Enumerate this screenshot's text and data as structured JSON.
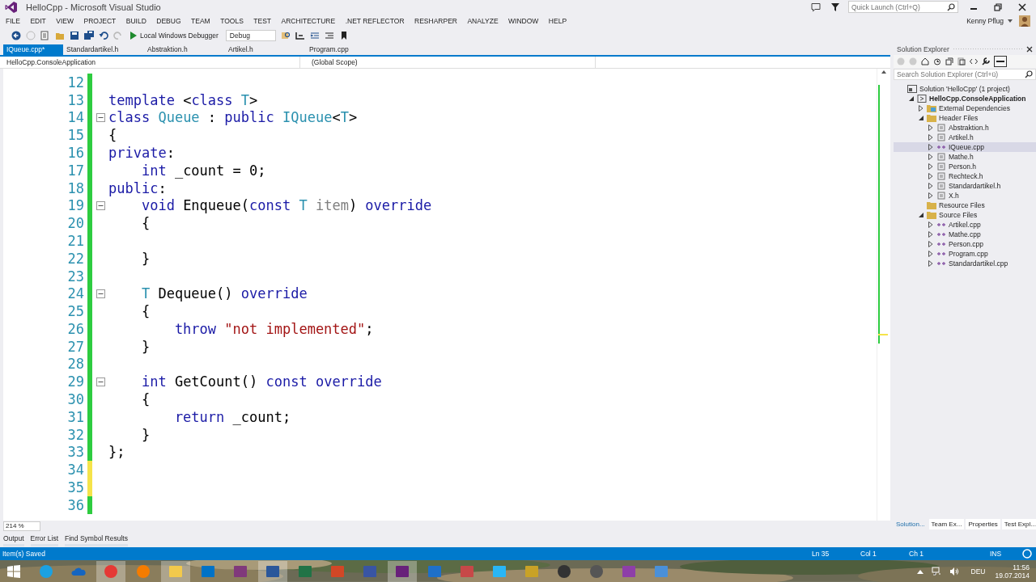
{
  "window": {
    "title": "HelloCpp - Microsoft Visual Studio",
    "quick_launch": {
      "placeholder": "Quick Launch (Ctrl+Q)"
    },
    "user": "Kenny Pflug"
  },
  "menu": [
    "FILE",
    "EDIT",
    "VIEW",
    "PROJECT",
    "BUILD",
    "DEBUG",
    "TEAM",
    "TOOLS",
    "TEST",
    "ARCHITECTURE",
    ".NET REFLECTOR",
    "RESHARPER",
    "ANALYZE",
    "WINDOW",
    "HELP"
  ],
  "toolbar": {
    "debugger": "Local Windows Debugger",
    "configuration": "Debug"
  },
  "document_tabs": [
    {
      "label": "IQueue.cpp*",
      "selected": true
    },
    {
      "label": "Standardartikel.h",
      "selected": false
    },
    {
      "label": "Abstraktion.h",
      "selected": false
    },
    {
      "label": "Artikel.h",
      "selected": false
    },
    {
      "label": "Program.cpp",
      "selected": false
    }
  ],
  "navigation_bar": {
    "project": "HelloCpp.ConsoleApplication",
    "scope": "(Global Scope)"
  },
  "editor": {
    "zoom": "214 %",
    "lines": [
      {
        "number": "12",
        "saved": true,
        "fold": false
      },
      {
        "number": "13",
        "saved": true,
        "fold": false,
        "tokens": [
          {
            "t": "template",
            "kind": "kw"
          },
          {
            "t": " <",
            "kind": "plain"
          },
          {
            "t": "class",
            "kind": "kw"
          },
          {
            "t": " T",
            "kind": "type"
          },
          {
            "t": ">",
            "kind": "plain"
          }
        ]
      },
      {
        "number": "14",
        "saved": true,
        "fold": true,
        "tokens": [
          {
            "t": "class",
            "kind": "kw"
          },
          {
            "t": " Queue",
            "kind": "type"
          },
          {
            "t": " : ",
            "kind": "plain"
          },
          {
            "t": "public",
            "kind": "kw"
          },
          {
            "t": " IQueue",
            "kind": "type"
          },
          {
            "t": "<",
            "kind": "plain"
          },
          {
            "t": "T",
            "kind": "type"
          },
          {
            "t": ">",
            "kind": "plain"
          }
        ]
      },
      {
        "number": "15",
        "saved": true,
        "fold": false,
        "tokens": [
          {
            "t": "{",
            "kind": "plain"
          }
        ]
      },
      {
        "number": "16",
        "saved": true,
        "fold": false,
        "tokens": [
          {
            "t": "private",
            "kind": "kw"
          },
          {
            "t": ":",
            "kind": "plain"
          }
        ]
      },
      {
        "number": "17",
        "saved": true,
        "fold": false,
        "tokens": [
          {
            "t": "    int",
            "kind": "kw"
          },
          {
            "t": " _count = 0;",
            "kind": "plain"
          }
        ]
      },
      {
        "number": "18",
        "saved": true,
        "fold": false,
        "tokens": [
          {
            "t": "public",
            "kind": "kw"
          },
          {
            "t": ":",
            "kind": "plain"
          }
        ]
      },
      {
        "number": "19",
        "saved": true,
        "fold": true,
        "tokens": [
          {
            "t": "    void",
            "kind": "kw"
          },
          {
            "t": " Enqueue(",
            "kind": "plain"
          },
          {
            "t": "const",
            "kind": "kw"
          },
          {
            "t": " T",
            "kind": "type"
          },
          {
            "t": " item",
            "kind": "param"
          },
          {
            "t": ") ",
            "kind": "plain"
          },
          {
            "t": "override",
            "kind": "kw"
          }
        ]
      },
      {
        "number": "20",
        "saved": true,
        "fold": false,
        "tokens": [
          {
            "t": "    {",
            "kind": "plain"
          }
        ]
      },
      {
        "number": "21",
        "saved": true,
        "fold": false
      },
      {
        "number": "22",
        "saved": true,
        "fold": false,
        "tokens": [
          {
            "t": "    }",
            "kind": "plain"
          }
        ]
      },
      {
        "number": "23",
        "saved": true,
        "fold": false
      },
      {
        "number": "24",
        "saved": true,
        "fold": true,
        "tokens": [
          {
            "t": "    T",
            "kind": "type"
          },
          {
            "t": " Dequeue() ",
            "kind": "plain"
          },
          {
            "t": "override",
            "kind": "kw"
          }
        ]
      },
      {
        "number": "25",
        "saved": true,
        "fold": false,
        "tokens": [
          {
            "t": "    {",
            "kind": "plain"
          }
        ]
      },
      {
        "number": "26",
        "saved": true,
        "fold": false,
        "tokens": [
          {
            "t": "        throw",
            "kind": "kw"
          },
          {
            "t": " \"not implemented\"",
            "kind": "str"
          },
          {
            "t": ";",
            "kind": "plain"
          }
        ]
      },
      {
        "number": "27",
        "saved": true,
        "fold": false,
        "tokens": [
          {
            "t": "    }",
            "kind": "plain"
          }
        ]
      },
      {
        "number": "28",
        "saved": true,
        "fold": false
      },
      {
        "number": "29",
        "saved": true,
        "fold": true,
        "tokens": [
          {
            "t": "    int",
            "kind": "kw"
          },
          {
            "t": " GetCount() ",
            "kind": "plain"
          },
          {
            "t": "const",
            "kind": "kw"
          },
          {
            "t": " override",
            "kind": "kw"
          }
        ]
      },
      {
        "number": "30",
        "saved": true,
        "fold": false,
        "tokens": [
          {
            "t": "    {",
            "kind": "plain"
          }
        ]
      },
      {
        "number": "31",
        "saved": true,
        "fold": false,
        "tokens": [
          {
            "t": "        return",
            "kind": "kw"
          },
          {
            "t": " _count;",
            "kind": "plain"
          }
        ]
      },
      {
        "number": "32",
        "saved": true,
        "fold": false,
        "tokens": [
          {
            "t": "    }",
            "kind": "plain"
          }
        ]
      },
      {
        "number": "33",
        "saved": true,
        "fold": false,
        "tokens": [
          {
            "t": "};",
            "kind": "plain"
          }
        ]
      },
      {
        "number": "34",
        "saved": false,
        "fold": false
      },
      {
        "number": "35",
        "saved": false,
        "fold": false
      },
      {
        "number": "36",
        "saved": true,
        "fold": false
      }
    ]
  },
  "solution_explorer": {
    "title": "Solution Explorer",
    "search": {
      "placeholder": "Search Solution Explorer (Ctrl+ü)"
    },
    "tree": [
      {
        "label": "Solution 'HelloCpp' (1 project)",
        "kind": "solution",
        "selected": false,
        "children": [
          {
            "label": "HelloCpp.ConsoleApplication",
            "kind": "project",
            "selected": false,
            "expanded": true,
            "children": [
              {
                "label": "External Dependencies",
                "kind": "deps",
                "selected": false,
                "expanded": false
              },
              {
                "label": "Header Files",
                "kind": "folder",
                "selected": false,
                "expanded": true,
                "children": [
                  {
                    "label": "Abstraktion.h",
                    "kind": "header",
                    "selected": false,
                    "expanded": false
                  },
                  {
                    "label": "Artikel.h",
                    "kind": "header",
                    "selected": false,
                    "expanded": false
                  },
                  {
                    "label": "IQueue.cpp",
                    "kind": "cpp",
                    "selected": true,
                    "expanded": false
                  },
                  {
                    "label": "Mathe.h",
                    "kind": "header",
                    "selected": false,
                    "expanded": false
                  },
                  {
                    "label": "Person.h",
                    "kind": "header",
                    "selected": false,
                    "expanded": false
                  },
                  {
                    "label": "Rechteck.h",
                    "kind": "header",
                    "selected": false,
                    "expanded": false
                  },
                  {
                    "label": "Standardartikel.h",
                    "kind": "header",
                    "selected": false,
                    "expanded": false
                  },
                  {
                    "label": "X.h",
                    "kind": "header",
                    "selected": false,
                    "expanded": false
                  }
                ]
              },
              {
                "label": "Resource Files",
                "kind": "folder",
                "selected": false
              },
              {
                "label": "Source Files",
                "kind": "folder",
                "selected": false,
                "expanded": true,
                "children": [
                  {
                    "label": "Artikel.cpp",
                    "kind": "cpp",
                    "selected": false,
                    "expanded": false
                  },
                  {
                    "label": "Mathe.cpp",
                    "kind": "cpp",
                    "selected": false,
                    "expanded": false
                  },
                  {
                    "label": "Person.cpp",
                    "kind": "cpp",
                    "selected": false,
                    "expanded": false
                  },
                  {
                    "label": "Program.cpp",
                    "kind": "cpp",
                    "selected": false,
                    "expanded": false
                  },
                  {
                    "label": "Standardartikel.cpp",
                    "kind": "cpp",
                    "selected": false,
                    "expanded": false
                  }
                ]
              }
            ]
          }
        ]
      }
    ],
    "tabs": [
      {
        "label": "Solution...",
        "selected": true
      },
      {
        "label": "Team Ex...",
        "selected": false
      },
      {
        "label": "Properties",
        "selected": false
      },
      {
        "label": "Test Expl...",
        "selected": false
      }
    ]
  },
  "bottom_tabs": [
    "Output",
    "Error List",
    "Find Symbol Results"
  ],
  "status_bar": {
    "message": "Item(s) Saved",
    "line": "Ln 35",
    "column": "Col 1",
    "char": "Ch 1",
    "mode": "INS"
  },
  "taskbar": {
    "apps": [
      {
        "kind": "circle",
        "color": "#1ba1e2",
        "selected": false
      },
      {
        "kind": "cloud",
        "color": "#1565c0",
        "selected": false
      },
      {
        "kind": "circle",
        "color": "#e53935",
        "selected": true
      },
      {
        "kind": "circle",
        "color": "#f57c00",
        "selected": false
      },
      {
        "kind": "tile",
        "color": "#f2c94c",
        "selected": true
      },
      {
        "kind": "tile",
        "color": "#0072c6",
        "selected": false
      },
      {
        "kind": "tile",
        "color": "#80397b",
        "selected": false
      },
      {
        "kind": "tile",
        "color": "#2b579a",
        "selected": true
      },
      {
        "kind": "tile",
        "color": "#217346",
        "selected": false
      },
      {
        "kind": "tile",
        "color": "#d24726",
        "selected": false
      },
      {
        "kind": "tile",
        "color": "#3955a3",
        "selected": false
      },
      {
        "kind": "tile",
        "color": "#68217a",
        "selected": true
      },
      {
        "kind": "tile",
        "color": "#1e70c9",
        "selected": false
      },
      {
        "kind": "tile",
        "color": "#c74848",
        "selected": false
      },
      {
        "kind": "tile",
        "color": "#29b6f6",
        "selected": false
      },
      {
        "kind": "tile",
        "color": "#c9a227",
        "selected": false
      },
      {
        "kind": "circle",
        "color": "#333333",
        "selected": false
      },
      {
        "kind": "circle",
        "color": "#555555",
        "selected": false
      },
      {
        "kind": "tile",
        "color": "#8e3fa8",
        "selected": false
      },
      {
        "kind": "tile",
        "color": "#4a90d9",
        "selected": false
      }
    ],
    "language": "DEU",
    "time": "11:56",
    "date": "19.07.2014"
  }
}
